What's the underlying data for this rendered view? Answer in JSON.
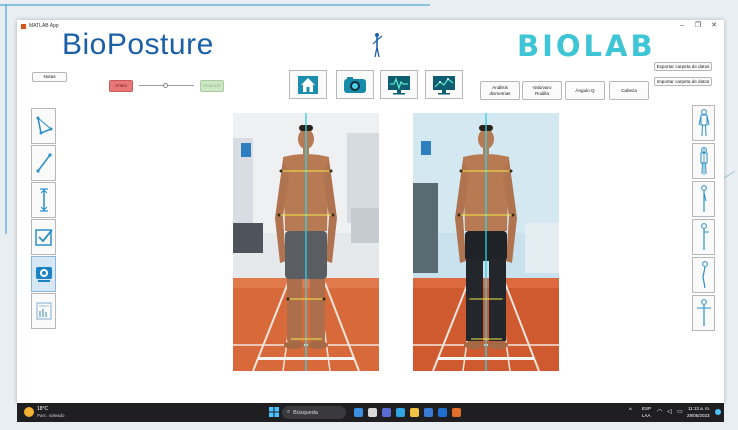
{
  "window": {
    "title": "MATLAB App",
    "minimize": "–",
    "maximize": "❐",
    "close": "✕"
  },
  "brand": {
    "left": "BioPosture",
    "right": "BIOLAB"
  },
  "controls": {
    "notas": "Notas",
    "antes": "Antes",
    "despues": "Después"
  },
  "nav": [
    "home-icon",
    "camera-icon",
    "monitor-icon",
    "chart-icon"
  ],
  "analysis_buttons": {
    "analisis": "Análisis\ndismetrias",
    "valgo": "Valo/varo\nRodilla",
    "angulo": "Ángulo Q",
    "cabeza": "Cabeza"
  },
  "data_buttons": {
    "exportar": "Exportar carpeta de datos",
    "importar": "Importar carpeta de datos"
  },
  "left_tools": [
    "angle-tool-icon",
    "line-tool-icon",
    "distance-tool-icon",
    "check-icon",
    "webcam-icon",
    "report-icon"
  ],
  "right_tools": [
    "posture-front-icon",
    "posture-back-icon",
    "posture-side-icon",
    "posture-side-arm-icon",
    "posture-lean-icon",
    "posture-tpose-icon"
  ],
  "taskbar": {
    "weather_temp": "18°C",
    "weather_desc": "Parc. soleado",
    "search": "Búsqueda",
    "lang_top": "ESP",
    "lang_bottom": "LAA",
    "time": "11:13 a. m.",
    "date": "29/05/2023"
  },
  "colors": {
    "brand_blue": "#1a5fa8",
    "brand_cyan": "#3ec5d6",
    "antes": "#e9777a",
    "despues": "#cde6c4"
  }
}
